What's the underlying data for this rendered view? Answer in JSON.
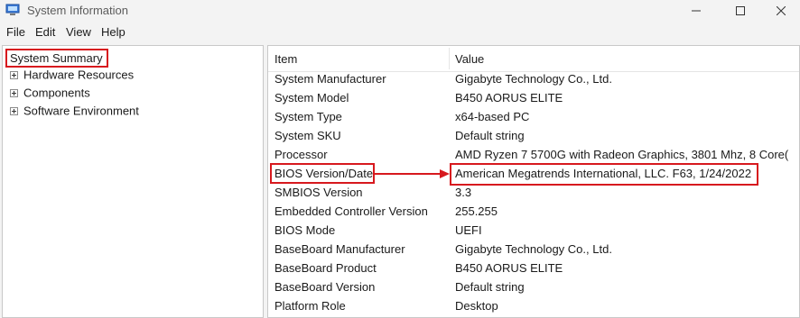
{
  "window": {
    "title": "System Information"
  },
  "menu": [
    "File",
    "Edit",
    "View",
    "Help"
  ],
  "tree": {
    "root": "System Summary",
    "children": [
      "Hardware Resources",
      "Components",
      "Software Environment"
    ]
  },
  "list": {
    "columns": {
      "item": "Item",
      "value": "Value"
    },
    "rows": [
      {
        "item": "System Manufacturer",
        "value": "Gigabyte Technology Co., Ltd."
      },
      {
        "item": "System Model",
        "value": "B450 AORUS ELITE"
      },
      {
        "item": "System Type",
        "value": "x64-based PC"
      },
      {
        "item": "System SKU",
        "value": "Default string"
      },
      {
        "item": "Processor",
        "value": "AMD Ryzen 7 5700G with Radeon Graphics, 3801 Mhz, 8 Core("
      },
      {
        "item": "BIOS Version/Date",
        "value": "American Megatrends International, LLC. F63, 1/24/2022"
      },
      {
        "item": "SMBIOS Version",
        "value": "3.3"
      },
      {
        "item": "Embedded Controller Version",
        "value": "255.255"
      },
      {
        "item": "BIOS Mode",
        "value": "UEFI"
      },
      {
        "item": "BaseBoard Manufacturer",
        "value": "Gigabyte Technology Co., Ltd."
      },
      {
        "item": "BaseBoard Product",
        "value": "B450 AORUS ELITE"
      },
      {
        "item": "BaseBoard Version",
        "value": "Default string"
      },
      {
        "item": "Platform Role",
        "value": "Desktop"
      }
    ]
  },
  "annotation_color": "#d7191e"
}
